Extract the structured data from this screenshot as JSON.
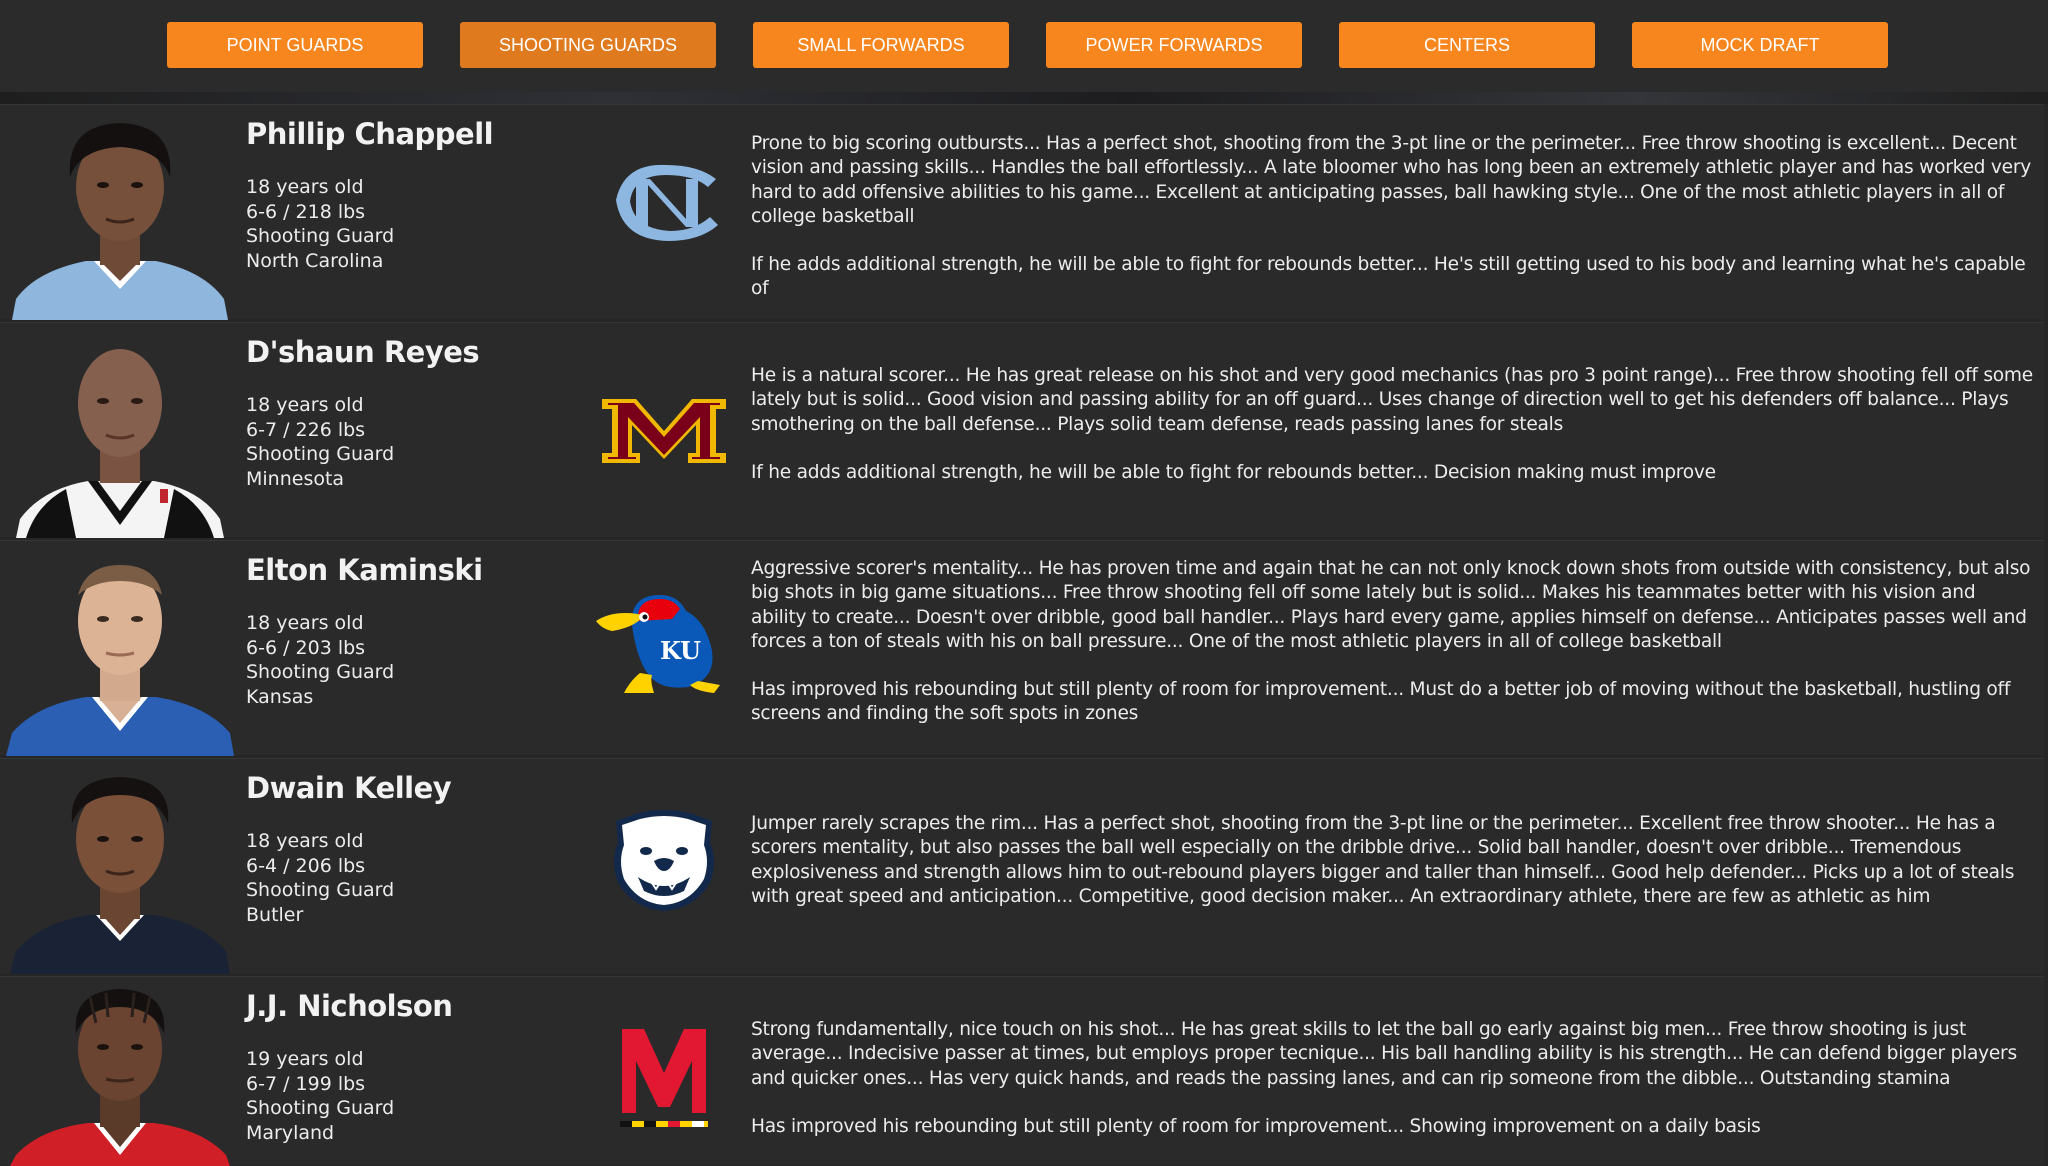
{
  "nav": {
    "buttons": [
      {
        "label": "POINT GUARDS"
      },
      {
        "label": "SHOOTING GUARDS"
      },
      {
        "label": "SMALL FORWARDS"
      },
      {
        "label": "POWER FORWARDS"
      },
      {
        "label": "CENTERS"
      },
      {
        "label": "MOCK DRAFT"
      }
    ],
    "active": "SHOOTING GUARDS",
    "accent_color": "#f7861e"
  },
  "players": [
    {
      "name": "Phillip Chappell",
      "age": "18 years old",
      "size": "6-6 / 218 lbs",
      "position": "Shooting Guard",
      "school": "North Carolina",
      "logo": "north-carolina-logo",
      "strengths": "Prone to big scoring outbursts... Has a perfect shot, shooting from the 3-pt line or the perimeter... Free throw shooting is excellent... Decent vision and passing skills... Handles the ball effortlessly... A late bloomer who has long been an extremely athletic player and has worked very hard to add offensive abilities to his game... Excellent at anticipating passes, ball hawking style... One of the most athletic players in all of college basketball",
      "weaknesses": "If he adds additional strength, he will be able to fight for rebounds better... He's still getting used to his body and learning what he's capable of"
    },
    {
      "name": "D'shaun Reyes",
      "age": "18 years old",
      "size": "6-7 / 226 lbs",
      "position": "Shooting Guard",
      "school": "Minnesota",
      "logo": "minnesota-logo",
      "strengths": "He is a natural scorer... He has great release on his shot and very good mechanics (has pro 3 point range)... Free throw shooting fell off some lately but is solid... Good vision and passing ability for an off guard... Uses change of direction well to get his defenders off balance... Plays smothering on the ball defense... Plays solid team defense, reads passing lanes for steals",
      "weaknesses": "If he adds additional strength, he will be able to fight for rebounds better... Decision making must improve"
    },
    {
      "name": "Elton Kaminski",
      "age": "18 years old",
      "size": "6-6 / 203 lbs",
      "position": "Shooting Guard",
      "school": "Kansas",
      "logo": "kansas-jayhawk-logo",
      "logo_text": "KU",
      "strengths": "Aggressive scorer's mentality... He has proven time and again that he can not only knock down shots from outside with consistency, but also big shots in big game situations... Free throw shooting fell off some lately but is solid... Makes his teammates better with his vision and ability to create... Doesn't over dribble, good ball handler... Plays hard every game, applies himself on defense... Anticipates passes well and forces a ton of steals with his on ball pressure... One of the most athletic players in all of college basketball",
      "weaknesses": "Has improved his rebounding but still plenty of room for improvement... Must do a better job of moving without the basketball, hustling off screens and finding the soft spots in zones"
    },
    {
      "name": "Dwain Kelley",
      "age": "18 years old",
      "size": "6-4 / 206 lbs",
      "position": "Shooting Guard",
      "school": "Butler",
      "logo": "butler-bulldog-logo",
      "strengths": "Jumper rarely scrapes the rim... Has a perfect shot, shooting from the 3-pt line or the perimeter... Excellent free throw shooter... He has a scorers mentality, but also passes the ball well especially on the dribble drive... Solid ball handler, doesn't over dribble... Tremendous explosiveness and strength allows him to out-rebound players bigger and taller than himself... Good help defender... Picks up a lot of steals with great speed and anticipation... Competitive, good decision maker... An extraordinary athlete, there are few as athletic as him",
      "weaknesses": ""
    },
    {
      "name": "J.J. Nicholson",
      "age": "19 years old",
      "size": "6-7 / 199 lbs",
      "position": "Shooting Guard",
      "school": "Maryland",
      "logo": "maryland-logo",
      "strengths": "Strong fundamentally, nice touch on his shot... He has great skills to let the ball go early against big men... Free throw shooting is just average... Indecisive passer at times, but employs proper tecnique... His ball handling ability is his strength... He can defend bigger players and quicker ones... Has very quick hands, and reads the passing lanes, and can rip someone from the dibble... Outstanding stamina",
      "weaknesses": "Has improved his rebounding but still plenty of room for improvement... Showing improvement on a daily basis"
    }
  ]
}
